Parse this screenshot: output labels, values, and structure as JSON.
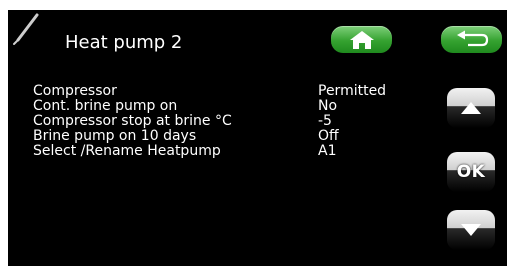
{
  "header": {
    "icon": "thermometer-probe-icon",
    "title": "Heat pump 2",
    "home_icon": "home-icon",
    "back_icon": "return-arrow-icon"
  },
  "settings": [
    {
      "label": "Compressor",
      "value": "Permitted"
    },
    {
      "label": "Cont. brine pump on",
      "value": "No"
    },
    {
      "label": "Compressor stop at brine °C",
      "value": "-5"
    },
    {
      "label": "Brine pump on 10 days",
      "value": "Off"
    },
    {
      "label": "Select /Rename Heatpump",
      "value": "A1"
    }
  ],
  "nav": {
    "up_icon": "triangle-up-icon",
    "ok_label": "OK",
    "down_icon": "triangle-down-icon"
  },
  "colors": {
    "background": "#000000",
    "text": "#ffffff",
    "accent_green": "#35a230"
  }
}
